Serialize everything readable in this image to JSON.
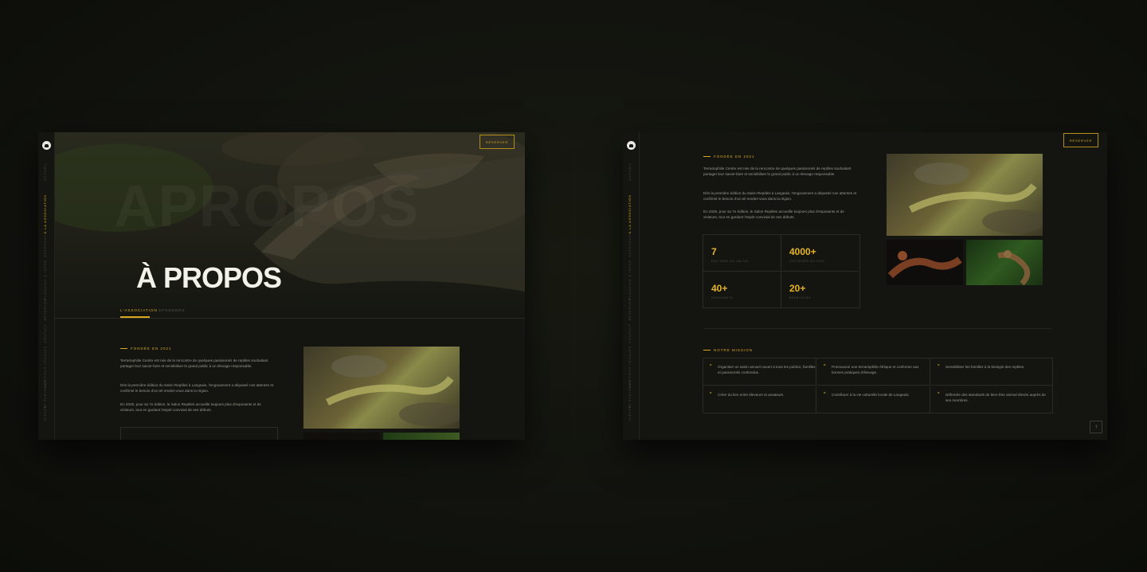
{
  "left_screen": {
    "reserve_label": "RÉSERVER",
    "nav": [
      "ACCUEIL",
      "À LA ASSOCIATION",
      "EXPOSANTS",
      "PLANNING & INFOS",
      "RÉSERVER",
      "CONTACT",
      "MENTIONS LÉGALES",
      "ET ÉLEVEURS",
      "D/EXPO"
    ],
    "hero_ghost": "APROPOS",
    "hero_title": "À PROPOS",
    "tabs": [
      "L'ASSOCIATION",
      "SPONSORS"
    ],
    "founded": "FONDÉE EN 2021",
    "paragraphs": [
      "Terrariophilie Centre est née de la rencontre de quelques passionnés de reptiles souhaitant partager leur savoir-faire et sensibiliser le grand public à un élevage responsable.",
      "Dès la première édition du Salon Reptiles à Langeais, l'engouement a dépassé nos attentes et confirmé le besoin d'un tel rendez-vous dans la région.",
      "En 2026, pour sa 7e édition, le Salon Reptiles accueille toujours plus d'exposants et de visiteurs, tout en gardant l'esprit convivial de ses débuts."
    ]
  },
  "right_screen": {
    "reserve_label": "RÉSERVER",
    "founded": "FONDÉE EN 2021",
    "paragraphs": [
      "Terrariophilie Centre est née de la rencontre de quelques passionnés de reptiles souhaitant partager leur savoir-faire et sensibiliser le grand public à un élevage responsable.",
      "Dès la première édition du Salon Reptiles à Langeais, l'engouement a dépassé nos attentes et confirmé le besoin d'un tel rendez-vous dans la région.",
      "En 2026, pour sa 7e édition, le Salon Reptiles accueille toujours plus d'exposants et de visiteurs, tout en gardant l'esprit convivial de ses débuts."
    ],
    "stats": [
      {
        "value": "7",
        "label": "ÉDITIONS DU SALON"
      },
      {
        "value": "4000+",
        "label": "VISITEURS EN 2025"
      },
      {
        "value": "40+",
        "label": "EXPOSANTS"
      },
      {
        "value": "20+",
        "label": "BÉNÉVOLES"
      }
    ],
    "mission_title": "NOTRE MISSION",
    "missions": [
      "Organiser un salon annuel ouvert à tous les publics, familles et passionnés confondus.",
      "Promouvoir une terrariophilie éthique et conforme aux bonnes pratiques d'élevage.",
      "Sensibiliser les familles à la biologie des reptiles.",
      "Créer du lien entre éleveurs et amateurs.",
      "Contribuer à la vie culturelle locale de Langeais.",
      "Défendre des standards de bien-être animal élevés auprès de ses membres."
    ],
    "up_icon": "arrow-up-icon"
  },
  "colors": {
    "accent": "#d9a820",
    "background": "#141511",
    "border": "#2a2b23"
  }
}
